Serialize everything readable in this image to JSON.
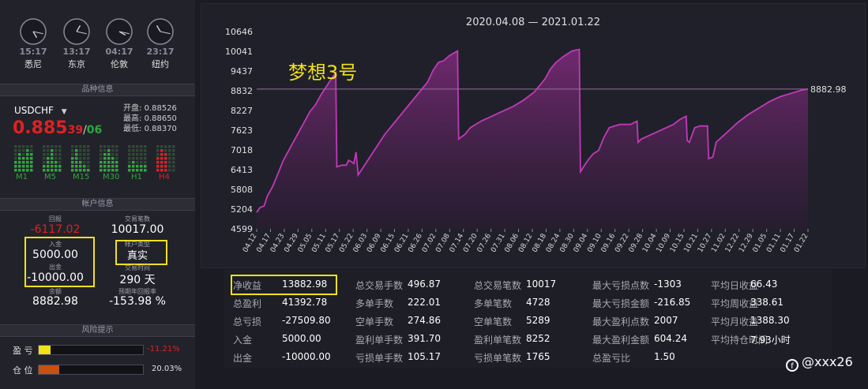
{
  "clocks": [
    {
      "time": "15:17",
      "city": "悉尼",
      "angle_h": 150,
      "angle_m": 102
    },
    {
      "time": "13:17",
      "city": "东京",
      "angle_h": 30,
      "angle_m": 102
    },
    {
      "time": "04:17",
      "city": "伦敦",
      "angle_h": 120,
      "angle_m": 102
    },
    {
      "time": "23:17",
      "city": "纽约",
      "angle_h": 330,
      "angle_m": 102
    }
  ],
  "symbol_section": {
    "title": "品种信息",
    "symbol": "USDCHF",
    "price_main": "0.885",
    "price_sub_a": "39",
    "price_slash": "/",
    "price_sub_b": "06",
    "open_label": "开盘:",
    "open": "0.88526",
    "high_label": "最高:",
    "high": "0.88650",
    "low_label": "最低:",
    "low": "0.88370",
    "timeframes": [
      "M1",
      "M5",
      "M15",
      "M30",
      "H1",
      "H4"
    ],
    "colors": {
      "up": "#2fa83c",
      "down": "#e02020",
      "price": "#e02020"
    }
  },
  "account": {
    "title": "帐户信息",
    "drawdown_label": "回报",
    "drawdown": "-6117.02",
    "deposit_label": "入金",
    "deposit": "5000.00",
    "withdraw_label": "出金",
    "withdraw": "-10000.00",
    "balance_label": "余额",
    "balance": "8882.98",
    "trades_label": "交易笔数",
    "trades": "10017.00",
    "acct_type_label": "帐户类型",
    "acct_type": "真实",
    "trade_time_label": "交易时间",
    "trade_time": "290 天",
    "annual_label": "预期年回报率",
    "annual": "-153.98 %"
  },
  "risk": {
    "title": "风险提示",
    "pl_label": "盈 亏",
    "pl_value": "-11.21%",
    "pl_fraction": 0.1121,
    "pos_label": "仓 位",
    "pos_value": "20.03%",
    "pos_fraction": 0.2003
  },
  "chart_data": {
    "type": "area",
    "title": "2020.04.08 — 2021.01.22",
    "annotation": "梦想3号",
    "last_value_label": "8882.98",
    "ylim": [
      4599,
      10646
    ],
    "yticks": [
      4599,
      5204,
      5808,
      6413,
      7018,
      7623,
      8227,
      8832,
      9437,
      10041,
      10646
    ],
    "xticks": [
      "04.12",
      "04.17",
      "04.23",
      "04.29",
      "05.05",
      "05.11",
      "05.17",
      "05.22",
      "06.03",
      "06.09",
      "06.15",
      "06.21",
      "06.26",
      "07.02",
      "07.08",
      "07.14",
      "07.20",
      "07.26",
      "07.31",
      "08.06",
      "08.12",
      "08.18",
      "08.24",
      "08.30",
      "09.04",
      "09.10",
      "09.16",
      "09.22",
      "09.28",
      "10.04",
      "10.09",
      "10.15",
      "10.21",
      "10.27",
      "11.02",
      "12.22",
      "12.29",
      "01.05",
      "01.11",
      "01.17",
      "01.22"
    ],
    "series": [
      {
        "values": [
          [
            0,
            5100
          ],
          [
            0.3,
            5250
          ],
          [
            0.7,
            5300
          ],
          [
            1,
            5600
          ],
          [
            1.5,
            5900
          ],
          [
            2,
            6300
          ],
          [
            2.5,
            6700
          ],
          [
            3,
            7000
          ],
          [
            3.5,
            7300
          ],
          [
            4,
            7600
          ],
          [
            4.5,
            7900
          ],
          [
            5,
            8200
          ],
          [
            5.5,
            8400
          ],
          [
            6,
            8700
          ],
          [
            6.5,
            8950
          ],
          [
            7,
            9200
          ],
          [
            7.4,
            9380
          ],
          [
            7.5,
            6500
          ],
          [
            8,
            6550
          ],
          [
            8.4,
            6550
          ],
          [
            8.6,
            6700
          ],
          [
            8.9,
            6650
          ],
          [
            9.1,
            6600
          ],
          [
            9.3,
            6950
          ],
          [
            9.5,
            6250
          ],
          [
            10,
            6500
          ],
          [
            11,
            7000
          ],
          [
            12,
            7500
          ],
          [
            13,
            7900
          ],
          [
            14,
            8300
          ],
          [
            15,
            8700
          ],
          [
            16,
            9100
          ],
          [
            16.5,
            9450
          ],
          [
            17,
            9700
          ],
          [
            17.5,
            9750
          ],
          [
            18,
            9900
          ],
          [
            18.8,
            10050
          ],
          [
            18.9,
            7350
          ],
          [
            19.5,
            7500
          ],
          [
            20,
            7700
          ],
          [
            21,
            7900
          ],
          [
            22,
            8050
          ],
          [
            23,
            8200
          ],
          [
            24,
            8350
          ],
          [
            25,
            8550
          ],
          [
            26,
            8800
          ],
          [
            26.5,
            9000
          ],
          [
            27,
            9200
          ],
          [
            27.5,
            9500
          ],
          [
            28,
            9700
          ],
          [
            28.7,
            9880
          ],
          [
            29.5,
            10050
          ],
          [
            30.2,
            10100
          ],
          [
            30.3,
            6350
          ],
          [
            31,
            6700
          ],
          [
            31.5,
            6900
          ],
          [
            32,
            7000
          ],
          [
            32.5,
            7400
          ],
          [
            33,
            7700
          ],
          [
            34,
            7800
          ],
          [
            35,
            7800
          ],
          [
            35.6,
            7900
          ],
          [
            35.7,
            7250
          ],
          [
            36,
            7350
          ],
          [
            37,
            7500
          ],
          [
            38,
            7650
          ],
          [
            39,
            7800
          ],
          [
            39.6,
            7950
          ],
          [
            40.2,
            8050
          ],
          [
            40.3,
            7300
          ],
          [
            40.5,
            7250
          ],
          [
            41,
            7700
          ],
          [
            41.5,
            7750
          ],
          [
            42.2,
            7750
          ],
          [
            42.3,
            6750
          ],
          [
            42.7,
            6800
          ],
          [
            43,
            7250
          ],
          [
            43.5,
            7400
          ],
          [
            44,
            7550
          ],
          [
            45,
            7850
          ],
          [
            46,
            8100
          ],
          [
            47,
            8300
          ],
          [
            48,
            8500
          ],
          [
            49,
            8650
          ],
          [
            50,
            8750
          ],
          [
            51,
            8850
          ],
          [
            51.6,
            8882.98
          ]
        ]
      }
    ],
    "xlim": [
      0,
      51.6
    ],
    "colors": {
      "line": "#c03ab8",
      "fill_top": "#7a2a78",
      "fill_bottom": "#2a1c32",
      "grid": "#3a3a46",
      "hline": "#9a6ca0"
    }
  },
  "stats": {
    "rows": [
      [
        [
          "净收益",
          "13882.98"
        ],
        [
          "总交易手数",
          "496.87"
        ],
        [
          "总交易笔数",
          "10017"
        ],
        [
          "最大亏损点数",
          "-1303"
        ],
        [
          "平均日收益",
          "66.43"
        ]
      ],
      [
        [
          "总盈利",
          "41392.78"
        ],
        [
          "多单手数",
          "222.01"
        ],
        [
          "多单笔数",
          "4728"
        ],
        [
          "最大亏损金额",
          "-216.85"
        ],
        [
          "平均周收益",
          "338.61"
        ]
      ],
      [
        [
          "总亏损",
          "-27509.80"
        ],
        [
          "空单手数",
          "274.86"
        ],
        [
          "空单笔数",
          "5289"
        ],
        [
          "最大盈利点数",
          "2007"
        ],
        [
          "平均月收益",
          "1388.30"
        ]
      ],
      [
        [
          "入金",
          "5000.00"
        ],
        [
          "盈利单手数",
          "391.70"
        ],
        [
          "盈利单笔数",
          "8252"
        ],
        [
          "最大盈利金额",
          "604.24"
        ],
        [
          "平均持仓时间",
          "7.93小时"
        ]
      ],
      [
        [
          "出金",
          "-10000.00"
        ],
        [
          "亏损单手数",
          "105.17"
        ],
        [
          "亏损单笔数",
          "1765"
        ],
        [
          "总盈亏比",
          "1.50"
        ],
        [
          "",
          ""
        ]
      ]
    ]
  },
  "watermark": "@xxx26"
}
